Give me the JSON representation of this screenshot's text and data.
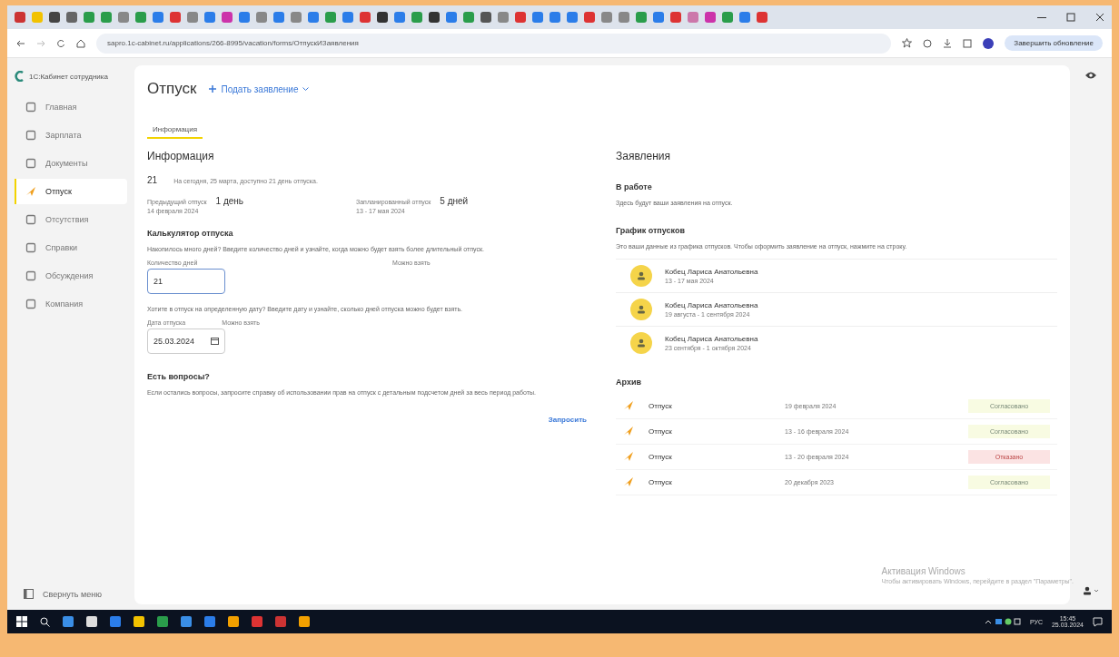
{
  "browser": {
    "url": "sapro.1c-cabinet.ru/applications/266-8995/vacation/forms/ОтпускИЗаявления",
    "update_button": "Завершить обновление"
  },
  "sidebar": {
    "logo": "1С:Кабинет сотрудника",
    "items": [
      {
        "label": "Главная",
        "selected": false
      },
      {
        "label": "Зарплата",
        "selected": false
      },
      {
        "label": "Документы",
        "selected": false
      },
      {
        "label": "Отпуск",
        "selected": true
      },
      {
        "label": "Отсутствия",
        "selected": false
      },
      {
        "label": "Справки",
        "selected": false
      },
      {
        "label": "Обсуждения",
        "selected": false
      },
      {
        "label": "Компания",
        "selected": false
      }
    ],
    "collapse": "Свернуть меню"
  },
  "header": {
    "title": "Отпуск",
    "action": "Подать заявление"
  },
  "tabs": [
    {
      "label": "Информация",
      "selected": true
    }
  ],
  "info": {
    "title": "Информация",
    "days": "21",
    "summary": "На сегодня, 25 марта, доступно 21 день отпуска.",
    "previous": {
      "label": "Предыдущий отпуск",
      "value": "1 день",
      "date": "14 февраля 2024"
    },
    "planned": {
      "label": "Запланированный отпуск",
      "value": "5 дней",
      "date": "13 - 17 мая 2024"
    }
  },
  "calculator": {
    "title": "Калькулятор отпуска",
    "hint1": "Накопилось много дней? Введите количество дней и узнайте, когда можно будет взять более длительный отпуск.",
    "days_label": "Количество дней",
    "days_value": "21",
    "can_take_label": "Можно взять",
    "hint2": "Хотите в отпуск на определенную дату? Введите дату и узнайте, сколько дней отпуска можно будет взять.",
    "date_label": "Дата отпуска",
    "date_can_take_label": "Можно взять",
    "date_value": "25.03.2024"
  },
  "questions": {
    "title": "Есть вопросы?",
    "text": "Если остались вопросы, запросите справку об использовании прав на отпуск с детальным подсчетом дней за весь период работы.",
    "button": "Запросить"
  },
  "requests": {
    "title": "Заявления",
    "in_work_title": "В работе",
    "in_work_text": "Здесь будут ваши заявления на отпуск.",
    "schedule_title": "График отпусков",
    "schedule_text": "Это ваши данные из графика отпусков. Чтобы оформить заявление на отпуск, нажмите на строку.",
    "schedule": [
      {
        "name": "Кобец Лариса Анатольевна",
        "dates": "13 - 17 мая 2024"
      },
      {
        "name": "Кобец Лариса Анатольевна",
        "dates": "19 августа - 1 сентября 2024"
      },
      {
        "name": "Кобец Лариса Анатольевна",
        "dates": "23 сентября - 1 октября 2024"
      }
    ],
    "archive_title": "Архив",
    "archive": [
      {
        "title": "Отпуск",
        "dates": "19 февраля 2024",
        "status": "Согласовано",
        "kind": "approved"
      },
      {
        "title": "Отпуск",
        "dates": "13 - 16 февраля 2024",
        "status": "Согласовано",
        "kind": "approved"
      },
      {
        "title": "Отпуск",
        "dates": "13 - 20 февраля 2024",
        "status": "Отказано",
        "kind": "rejected"
      },
      {
        "title": "Отпуск",
        "dates": "20 декабря 2023",
        "status": "Согласовано",
        "kind": "approved"
      }
    ]
  },
  "activation": {
    "title": "Активация Windows",
    "text": "Чтобы активировать Windows, перейдите в раздел \"Параметры\"."
  },
  "taskbar": {
    "language": "РУС",
    "time": "15:45",
    "date": "25.03.2024"
  }
}
